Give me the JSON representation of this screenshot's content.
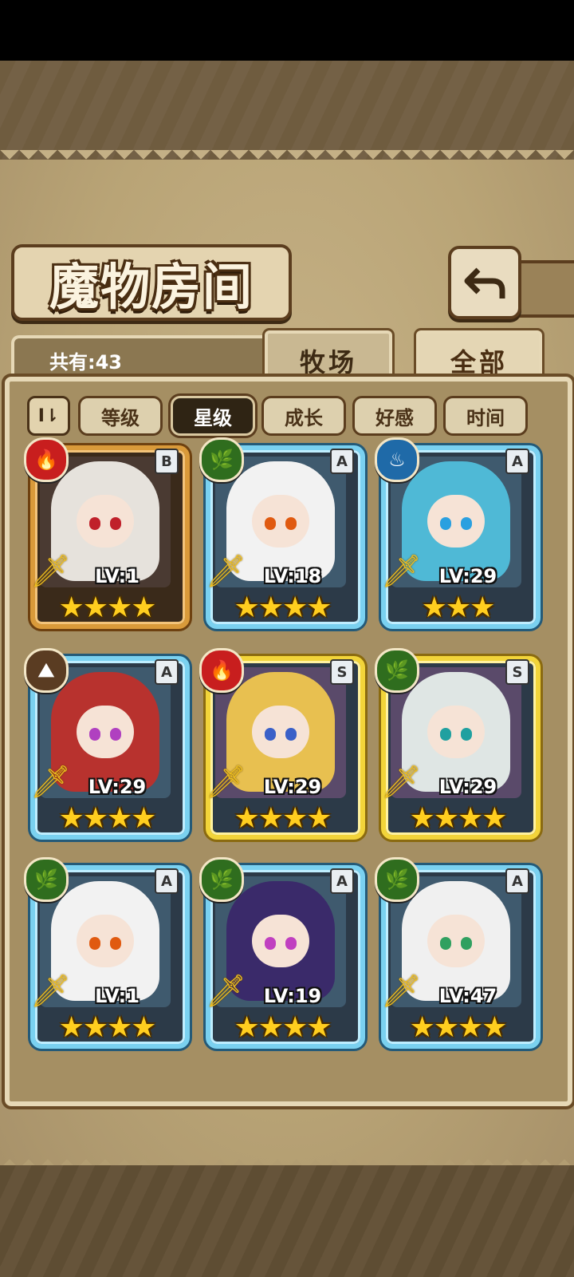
{
  "header": {
    "title": "魔物房间"
  },
  "summary": {
    "count_label": "共有:43"
  },
  "tabs": [
    {
      "label": "牧场",
      "active": false
    },
    {
      "label": "全部",
      "active": true
    }
  ],
  "sort": {
    "toggle_label": "I⇂",
    "options": [
      {
        "label": "等级",
        "active": false
      },
      {
        "label": "星级",
        "active": true
      },
      {
        "label": "成长",
        "active": false
      },
      {
        "label": "好感",
        "active": false
      },
      {
        "label": "时间",
        "active": false
      }
    ]
  },
  "monsters": [
    {
      "level": "LV:1",
      "grade": "B",
      "element": "fire",
      "element_glyph": "🔥",
      "stars": 4,
      "frame": "bronze",
      "hair_color": "#e6e2dc",
      "eye_color": "#c0202a"
    },
    {
      "level": "LV:18",
      "grade": "A",
      "element": "wood",
      "element_glyph": "🌿",
      "stars": 4,
      "frame": "blue",
      "hair_color": "#f2f2f2",
      "eye_color": "#e05a10"
    },
    {
      "level": "LV:29",
      "grade": "A",
      "element": "water",
      "element_glyph": "♨",
      "stars": 3,
      "frame": "blue",
      "hair_color": "#4fb9d6",
      "eye_color": "#2aa0e0"
    },
    {
      "level": "LV:29",
      "grade": "A",
      "element": "earth",
      "element_glyph": "⛰",
      "stars": 4,
      "frame": "blue",
      "hair_color": "#b8322e",
      "eye_color": "#b040c0"
    },
    {
      "level": "LV:29",
      "grade": "S",
      "element": "fire",
      "element_glyph": "🔥",
      "stars": 4,
      "frame": "gold",
      "hair_color": "#e8c050",
      "eye_color": "#3a60c8"
    },
    {
      "level": "LV:29",
      "grade": "S",
      "element": "wood",
      "element_glyph": "🌿",
      "stars": 4,
      "frame": "gold",
      "hair_color": "#dfe6e4",
      "eye_color": "#20a0a0"
    },
    {
      "level": "LV:1",
      "grade": "A",
      "element": "wood",
      "element_glyph": "🌿",
      "stars": 4,
      "frame": "blue",
      "hair_color": "#f2f2f2",
      "eye_color": "#e05a10"
    },
    {
      "level": "LV:19",
      "grade": "A",
      "element": "wood",
      "element_glyph": "🌿",
      "stars": 4,
      "frame": "blue",
      "hair_color": "#3a2a6a",
      "eye_color": "#c040c0"
    },
    {
      "level": "LV:47",
      "grade": "A",
      "element": "wood",
      "element_glyph": "🌿",
      "stars": 4,
      "frame": "blue",
      "hair_color": "#f0f0f0",
      "eye_color": "#30a060"
    }
  ]
}
